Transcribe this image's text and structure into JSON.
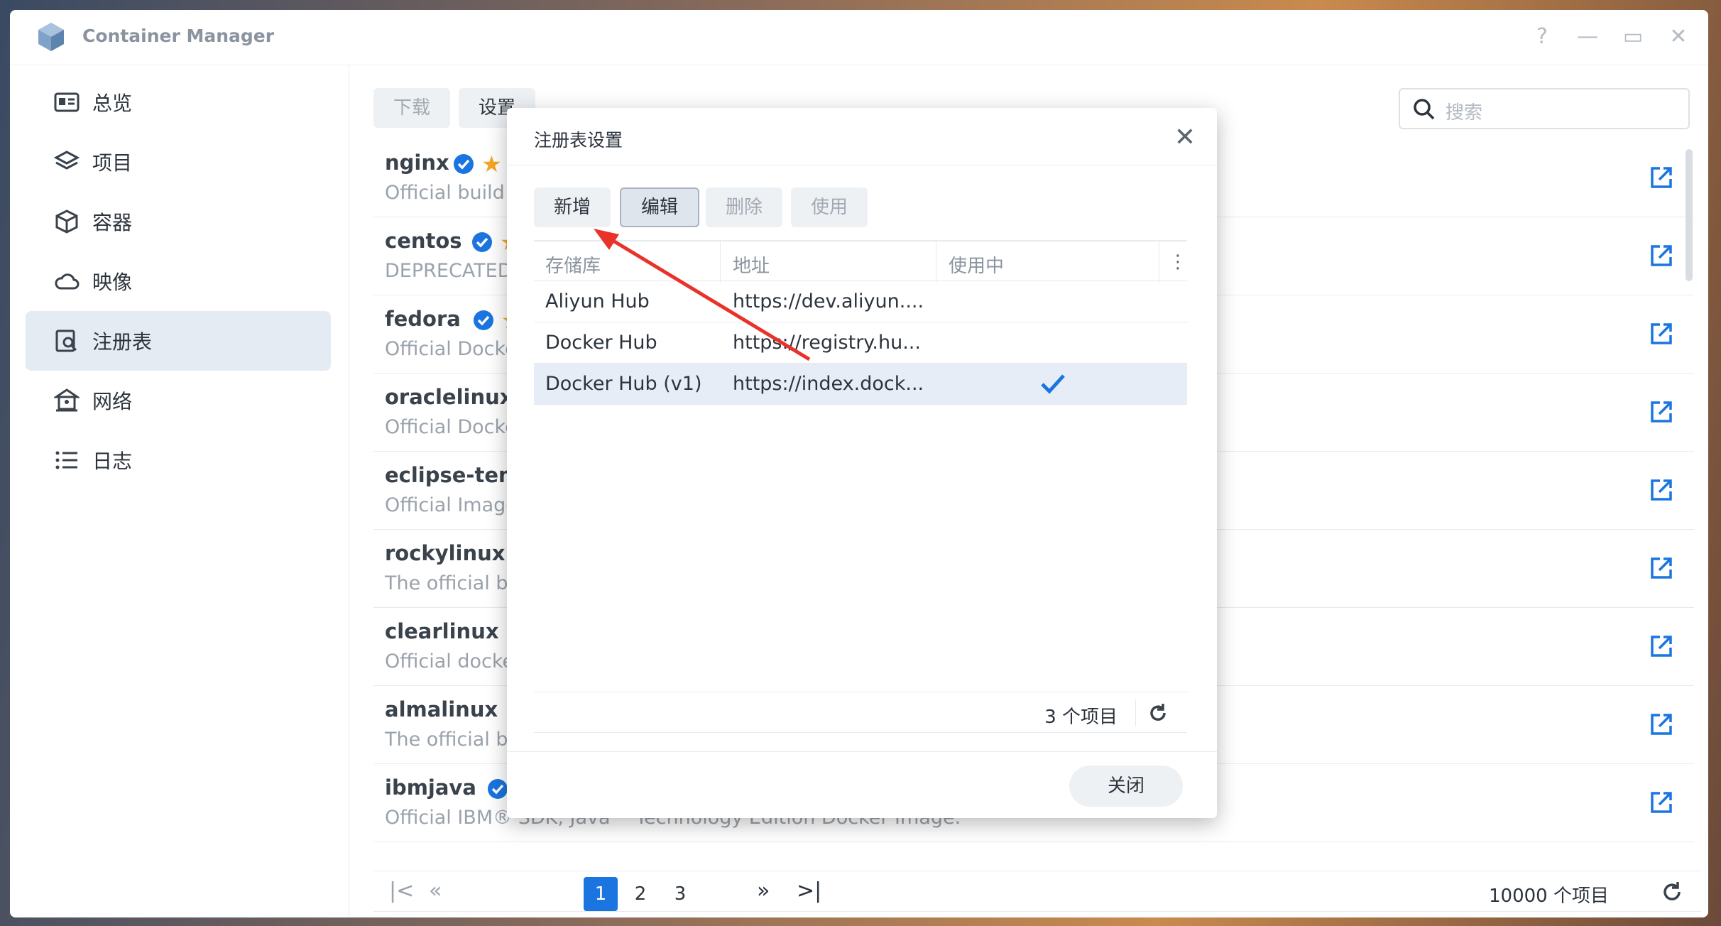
{
  "app": {
    "title": "Container Manager"
  },
  "window_controls": {
    "help": "?",
    "minimize": "—",
    "maximize": "▭",
    "close": "✕"
  },
  "sidebar": {
    "items": [
      {
        "label": "总览",
        "icon": "overview-icon"
      },
      {
        "label": "项目",
        "icon": "layers-icon"
      },
      {
        "label": "容器",
        "icon": "cube-icon"
      },
      {
        "label": "映像",
        "icon": "cloud-icon"
      },
      {
        "label": "注册表",
        "icon": "registry-search-icon",
        "active": true
      },
      {
        "label": "网络",
        "icon": "network-icon"
      },
      {
        "label": "日志",
        "icon": "list-icon"
      }
    ]
  },
  "toolbar": {
    "download_label": "下载",
    "settings_label": "设置"
  },
  "search": {
    "placeholder": "搜索"
  },
  "registry_list": [
    {
      "name": "nginx",
      "desc": "Official build"
    },
    {
      "name": "centos",
      "desc": "DEPRECATED"
    },
    {
      "name": "fedora",
      "desc": "Official Docke"
    },
    {
      "name": "oraclelinux",
      "desc": "Official Docke"
    },
    {
      "name": "eclipse-tem",
      "desc": "Official Image"
    },
    {
      "name": "rockylinux",
      "desc": "The official b"
    },
    {
      "name": "clearlinux",
      "desc": "Official docke"
    },
    {
      "name": "almalinux",
      "desc": "The official b"
    },
    {
      "name": "ibmjava",
      "desc": "Official IBM® SDK, Java™ Technology Edition Docker Image."
    }
  ],
  "pagination": {
    "pages": [
      "1",
      "2",
      "3"
    ],
    "current": "1",
    "total": "10000 个项目"
  },
  "modal": {
    "title": "注册表设置",
    "buttons": {
      "add": "新增",
      "edit": "编辑",
      "delete": "删除",
      "use": "使用"
    },
    "columns": {
      "repo": "存储库",
      "address": "地址",
      "in_use": "使用中"
    },
    "rows": [
      {
        "repo": "Aliyun Hub",
        "address": "https://dev.aliyun....",
        "in_use": false
      },
      {
        "repo": "Docker Hub",
        "address": "https://registry.hu...",
        "in_use": false
      },
      {
        "repo": "Docker Hub (v1)",
        "address": "https://index.dock...",
        "in_use": true
      }
    ],
    "count": "3 个项目",
    "close_label": "关闭"
  },
  "colors": {
    "accent": "#1a75e0",
    "annotation_arrow": "#e8322a",
    "star": "#f5a623"
  }
}
